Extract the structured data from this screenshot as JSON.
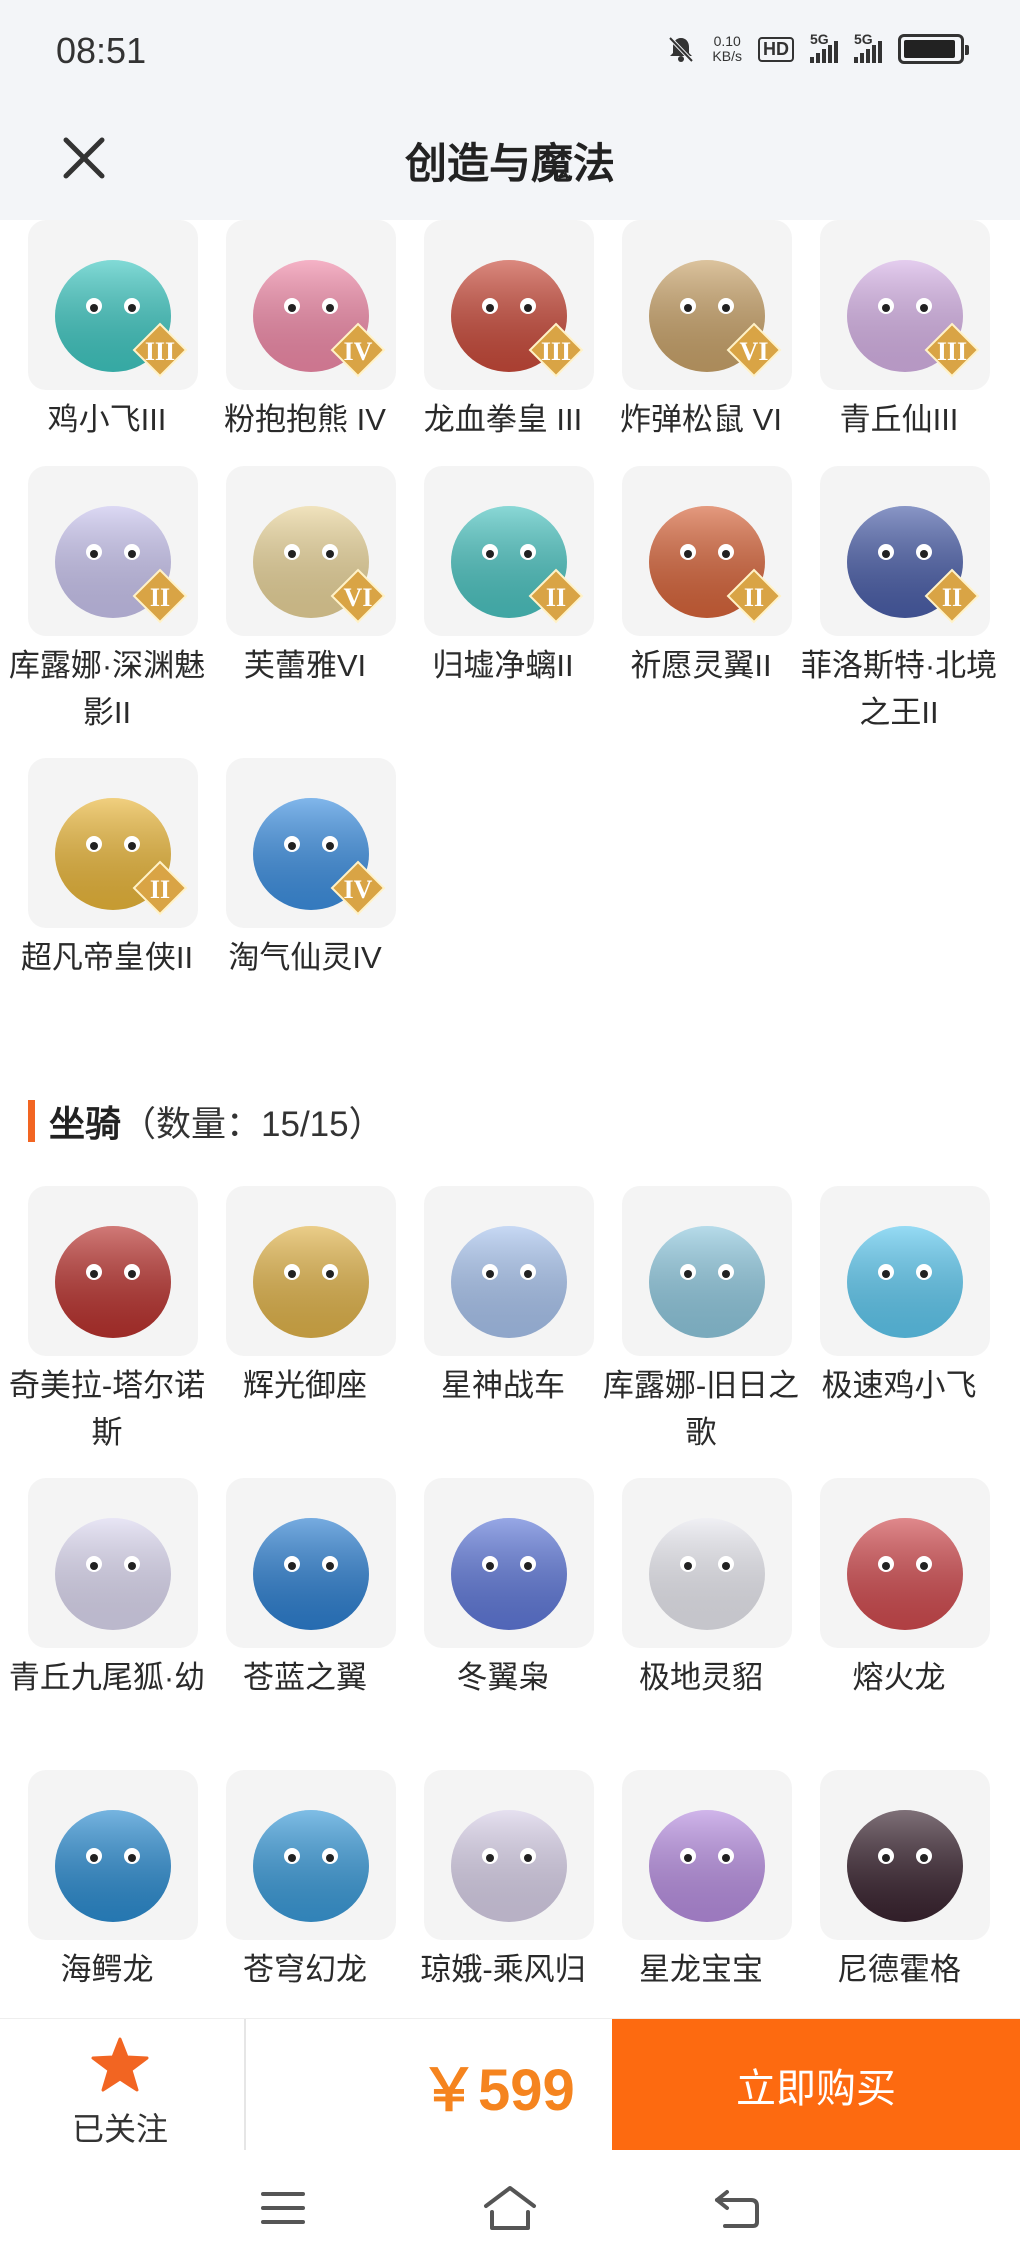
{
  "status_bar": {
    "time": "08:51",
    "net_speed_value": "0.10",
    "net_speed_unit": "KB/s",
    "hd_label": "HD",
    "sim1_label": "5G",
    "sim2_label": "5G"
  },
  "header": {
    "title": "创造与魔法",
    "close_icon": "close-icon"
  },
  "grid_top": [
    {
      "label": "鸡小飞III",
      "tier": "III",
      "color": "#3fc7c1"
    },
    {
      "label": "粉抱抱熊 IV",
      "tier": "IV",
      "color": "#f08aa8"
    },
    {
      "label": "龙血拳皇 III",
      "tier": "III",
      "color": "#c84a3a"
    },
    {
      "label": "炸弹松鼠 VI",
      "tier": "VI",
      "color": "#c9a36a"
    },
    {
      "label": "青丘仙III",
      "tier": "III",
      "color": "#d6b2e6"
    },
    {
      "label": "库露娜·深渊魅影II",
      "tier": "II",
      "color": "#c9c4ee"
    },
    {
      "label": "芙蕾雅VI",
      "tier": "VI",
      "color": "#e9d49a"
    },
    {
      "label": "归墟净螭II",
      "tier": "II",
      "color": "#4bc3c0"
    },
    {
      "label": "祈愿灵翼II",
      "tier": "II",
      "color": "#d6643a"
    },
    {
      "label": "菲洛斯特·北境之王II",
      "tier": "II",
      "color": "#4a5ea8"
    },
    {
      "label": "超凡帝皇侠II",
      "tier": "II",
      "color": "#e9b63a"
    },
    {
      "label": "淘气仙灵IV",
      "tier": "IV",
      "color": "#3d8fe0"
    }
  ],
  "mounts_section": {
    "name": "坐骑",
    "count_text": "（数量：15/15）"
  },
  "grid_mounts": [
    {
      "label": "奇美拉-塔尔诺斯",
      "color": "#b8322e"
    },
    {
      "label": "辉光御座",
      "color": "#e0b34a"
    },
    {
      "label": "星神战车",
      "color": "#a9c4ee"
    },
    {
      "label": "库露娜-旧日之歌",
      "color": "#8fc8de"
    },
    {
      "label": "极速鸡小飞",
      "color": "#5ec8ef"
    },
    {
      "label": "青丘九尾狐·幼",
      "color": "#dcd8f0"
    },
    {
      "label": "苍蓝之翼",
      "color": "#2d7fd0"
    },
    {
      "label": "冬翼枭",
      "color": "#5f78d8"
    },
    {
      "label": "极地灵貂",
      "color": "#e8e8ef"
    },
    {
      "label": "熔火龙",
      "color": "#cf4a4e"
    },
    {
      "label": "海鳄龙",
      "color": "#2c8cd0"
    },
    {
      "label": "苍穹幻龙",
      "color": "#3a9ad8"
    },
    {
      "label": "琼娥-乘风归",
      "color": "#d8d0e8"
    },
    {
      "label": "星龙宝宝",
      "color": "#b78ee0"
    },
    {
      "label": "尼德霍格",
      "color": "#3a2430"
    }
  ],
  "bottom_bar": {
    "follow_label": "已关注",
    "star_icon": "star-icon",
    "price": "￥599",
    "buy_label": "立即购买"
  },
  "colors": {
    "accent": "#fd6a10",
    "price": "#f5841f",
    "section_bar": "#f26522",
    "header_bg": "#f3f5f8",
    "badge": "#d9a445"
  },
  "nav_bar": {
    "icons": [
      "menu-icon",
      "home-icon",
      "back-icon"
    ]
  }
}
